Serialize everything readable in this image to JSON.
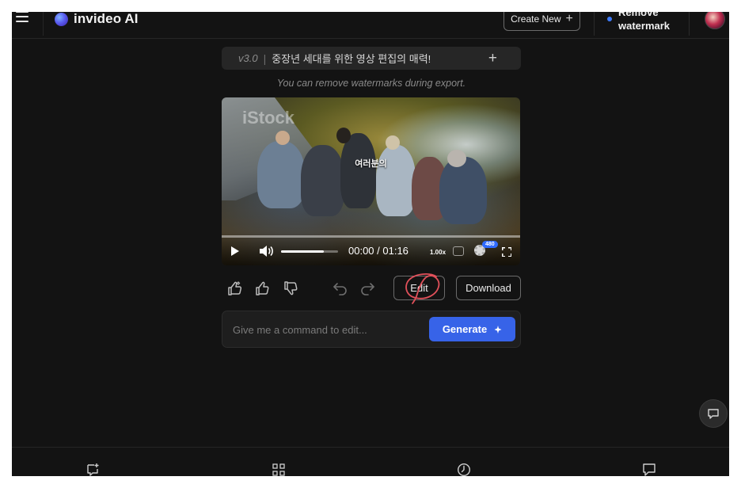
{
  "header": {
    "brand": "invideo AI",
    "create_new_label": "Create New",
    "remove_watermark_label": "Remove watermark",
    "icons": [
      "menu-icon",
      "logo-icon",
      "plus-icon",
      "watermark-dot-icon",
      "avatar"
    ]
  },
  "project": {
    "version": "v3.0",
    "separator": "|",
    "title": "중장년 세대를 위한 영상 편집의 매력!",
    "add_label": "+"
  },
  "hint": "You can remove watermarks during export.",
  "video": {
    "watermark_text": "iStock",
    "caption": "여러분의",
    "progress": 0,
    "volume": 0.75,
    "current_time": "00:00",
    "duration": "01:16",
    "time_display": "00:00 / 01:16",
    "speed": "1.00x",
    "quality": "480",
    "icons": [
      "play-icon",
      "volume-icon",
      "loop-icon",
      "gear-icon",
      "fullscreen-icon"
    ]
  },
  "actions": {
    "edit_label": "Edit",
    "download_label": "Download",
    "icons": [
      "love-icon",
      "thumbs-up-icon",
      "thumbs-down-icon",
      "undo-icon",
      "redo-icon"
    ]
  },
  "command": {
    "placeholder": "Give me a command to edit...",
    "generate_label": "Generate"
  },
  "bottom_nav": {
    "icons": [
      "new-chat-icon",
      "grid-icon",
      "history-icon",
      "chat-icon"
    ]
  },
  "colors": {
    "background": "#131313",
    "accent": "#3763e8",
    "annotation": "#e0505a"
  }
}
